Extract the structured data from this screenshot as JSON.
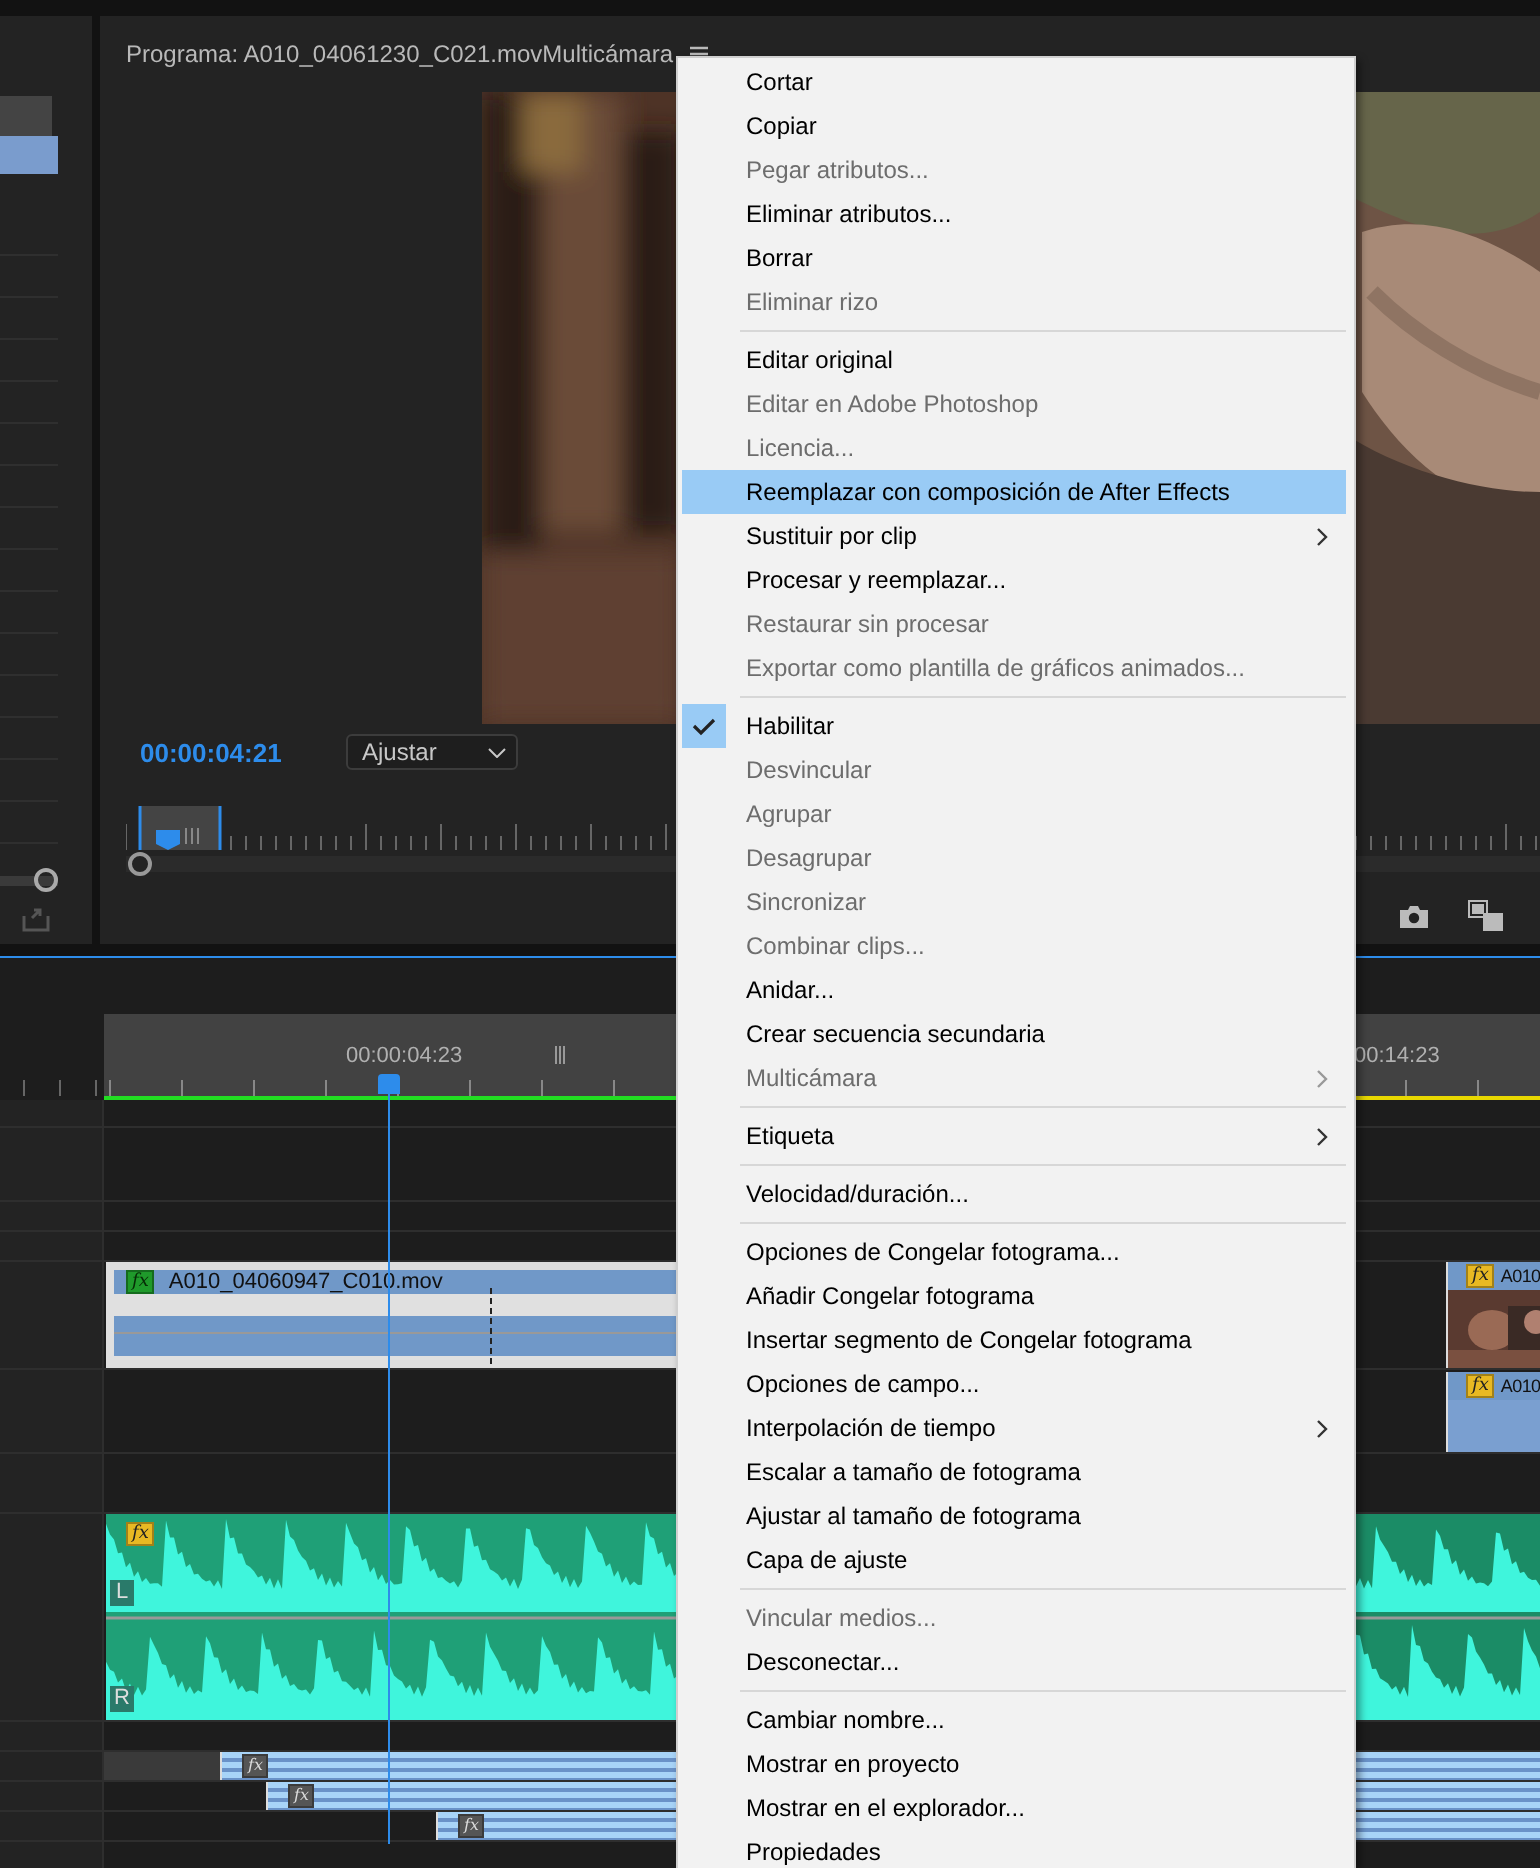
{
  "monitor": {
    "title": "Programa: A010_04061230_C021.movMulticámara",
    "timecode": "00:00:04:21",
    "zoom": "Ajustar"
  },
  "timeline": {
    "playhead_timecode": "00:00:04:23",
    "timecode_2": "00:14:23",
    "video_clips": [
      {
        "kind": "main",
        "name": "A010_04060947_C010.mov",
        "fx": "fx"
      },
      {
        "kind": "thumbnail",
        "name": "A010",
        "fx": "fx"
      },
      {
        "kind": "plain",
        "name": "A010",
        "fx": "fx"
      }
    ],
    "audio_clip": {
      "fx": "fx",
      "channels": [
        "L",
        "R"
      ]
    },
    "sub_clips": [
      {
        "fx": "fx"
      },
      {
        "fx": "fx"
      },
      {
        "fx": "fx"
      }
    ]
  },
  "context_menu": {
    "items": [
      {
        "kind": "item",
        "label": "Cortar",
        "disabled": false,
        "selected": false,
        "checked": false,
        "submenu": false
      },
      {
        "kind": "item",
        "label": "Copiar",
        "disabled": false,
        "selected": false,
        "checked": false,
        "submenu": false
      },
      {
        "kind": "item",
        "label": "Pegar atributos...",
        "disabled": true,
        "selected": false,
        "checked": false,
        "submenu": false
      },
      {
        "kind": "item",
        "label": "Eliminar atributos...",
        "disabled": false,
        "selected": false,
        "checked": false,
        "submenu": false
      },
      {
        "kind": "item",
        "label": "Borrar",
        "disabled": false,
        "selected": false,
        "checked": false,
        "submenu": false
      },
      {
        "kind": "item",
        "label": "Eliminar rizo",
        "disabled": true,
        "selected": false,
        "checked": false,
        "submenu": false
      },
      {
        "kind": "separator"
      },
      {
        "kind": "item",
        "label": "Editar original",
        "disabled": false,
        "selected": false,
        "checked": false,
        "submenu": false
      },
      {
        "kind": "item",
        "label": "Editar en Adobe Photoshop",
        "disabled": true,
        "selected": false,
        "checked": false,
        "submenu": false
      },
      {
        "kind": "item",
        "label": "Licencia...",
        "disabled": true,
        "selected": false,
        "checked": false,
        "submenu": false
      },
      {
        "kind": "item",
        "label": "Reemplazar con composición de After Effects",
        "disabled": false,
        "selected": true,
        "checked": false,
        "submenu": false
      },
      {
        "kind": "item",
        "label": "Sustituir por clip",
        "disabled": false,
        "selected": false,
        "checked": false,
        "submenu": true
      },
      {
        "kind": "item",
        "label": "Procesar y reemplazar...",
        "disabled": false,
        "selected": false,
        "checked": false,
        "submenu": false
      },
      {
        "kind": "item",
        "label": "Restaurar sin procesar",
        "disabled": true,
        "selected": false,
        "checked": false,
        "submenu": false
      },
      {
        "kind": "item",
        "label": "Exportar como plantilla de gráficos animados...",
        "disabled": true,
        "selected": false,
        "checked": false,
        "submenu": false
      },
      {
        "kind": "separator"
      },
      {
        "kind": "item",
        "label": "Habilitar",
        "disabled": false,
        "selected": false,
        "checked": true,
        "submenu": false
      },
      {
        "kind": "item",
        "label": "Desvincular",
        "disabled": true,
        "selected": false,
        "checked": false,
        "submenu": false
      },
      {
        "kind": "item",
        "label": "Agrupar",
        "disabled": true,
        "selected": false,
        "checked": false,
        "submenu": false
      },
      {
        "kind": "item",
        "label": "Desagrupar",
        "disabled": true,
        "selected": false,
        "checked": false,
        "submenu": false
      },
      {
        "kind": "item",
        "label": "Sincronizar",
        "disabled": true,
        "selected": false,
        "checked": false,
        "submenu": false
      },
      {
        "kind": "item",
        "label": "Combinar clips...",
        "disabled": true,
        "selected": false,
        "checked": false,
        "submenu": false
      },
      {
        "kind": "item",
        "label": "Anidar...",
        "disabled": false,
        "selected": false,
        "checked": false,
        "submenu": false
      },
      {
        "kind": "item",
        "label": "Crear secuencia secundaria",
        "disabled": false,
        "selected": false,
        "checked": false,
        "submenu": false
      },
      {
        "kind": "item",
        "label": "Multicámara",
        "disabled": true,
        "selected": false,
        "checked": false,
        "submenu": true
      },
      {
        "kind": "separator"
      },
      {
        "kind": "item",
        "label": "Etiqueta",
        "disabled": false,
        "selected": false,
        "checked": false,
        "submenu": true
      },
      {
        "kind": "separator"
      },
      {
        "kind": "item",
        "label": "Velocidad/duración...",
        "disabled": false,
        "selected": false,
        "checked": false,
        "submenu": false
      },
      {
        "kind": "separator"
      },
      {
        "kind": "item",
        "label": "Opciones de Congelar fotograma...",
        "disabled": false,
        "selected": false,
        "checked": false,
        "submenu": false
      },
      {
        "kind": "item",
        "label": "Añadir Congelar fotograma",
        "disabled": false,
        "selected": false,
        "checked": false,
        "submenu": false
      },
      {
        "kind": "item",
        "label": "Insertar segmento de Congelar fotograma",
        "disabled": false,
        "selected": false,
        "checked": false,
        "submenu": false
      },
      {
        "kind": "item",
        "label": "Opciones de campo...",
        "disabled": false,
        "selected": false,
        "checked": false,
        "submenu": false
      },
      {
        "kind": "item",
        "label": "Interpolación de tiempo",
        "disabled": false,
        "selected": false,
        "checked": false,
        "submenu": true
      },
      {
        "kind": "item",
        "label": "Escalar a tamaño de fotograma",
        "disabled": false,
        "selected": false,
        "checked": false,
        "submenu": false
      },
      {
        "kind": "item",
        "label": "Ajustar al tamaño de fotograma",
        "disabled": false,
        "selected": false,
        "checked": false,
        "submenu": false
      },
      {
        "kind": "item",
        "label": "Capa de ajuste",
        "disabled": false,
        "selected": false,
        "checked": false,
        "submenu": false
      },
      {
        "kind": "separator"
      },
      {
        "kind": "item",
        "label": "Vincular medios...",
        "disabled": true,
        "selected": false,
        "checked": false,
        "submenu": false
      },
      {
        "kind": "item",
        "label": "Desconectar...",
        "disabled": false,
        "selected": false,
        "checked": false,
        "submenu": false
      },
      {
        "kind": "separator"
      },
      {
        "kind": "item",
        "label": "Cambiar nombre...",
        "disabled": false,
        "selected": false,
        "checked": false,
        "submenu": false
      },
      {
        "kind": "item",
        "label": "Mostrar en proyecto",
        "disabled": false,
        "selected": false,
        "checked": false,
        "submenu": false
      },
      {
        "kind": "item",
        "label": "Mostrar en el explorador...",
        "disabled": false,
        "selected": false,
        "checked": false,
        "submenu": false
      },
      {
        "kind": "item",
        "label": "Propiedades",
        "disabled": false,
        "selected": false,
        "checked": false,
        "submenu": false
      }
    ]
  }
}
